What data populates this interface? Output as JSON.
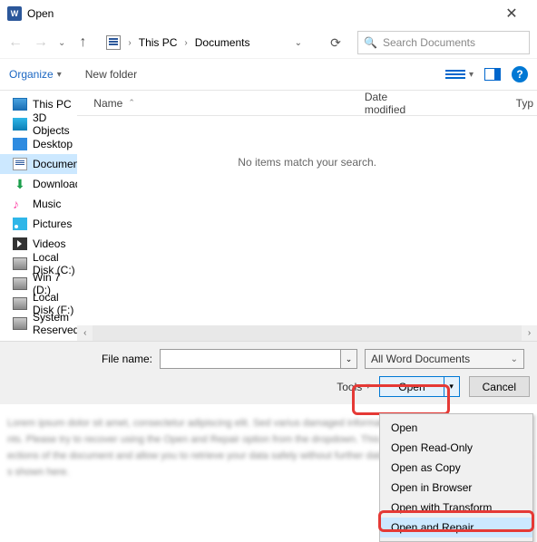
{
  "title": "Open",
  "breadcrumb": {
    "root": "This PC",
    "folder": "Documents"
  },
  "search_placeholder": "Search Documents",
  "toolbar": {
    "organize": "Organize",
    "newfolder": "New folder"
  },
  "tree": [
    {
      "label": "This PC",
      "icon": "i-pc"
    },
    {
      "label": "3D Objects",
      "icon": "i-3d"
    },
    {
      "label": "Desktop",
      "icon": "i-desk"
    },
    {
      "label": "Documents",
      "icon": "i-doc",
      "selected": true
    },
    {
      "label": "Downloads",
      "icon": "i-dl",
      "glyph": "⬇"
    },
    {
      "label": "Music",
      "icon": "i-mus",
      "glyph": "♪"
    },
    {
      "label": "Pictures",
      "icon": "i-pic"
    },
    {
      "label": "Videos",
      "icon": "i-vid"
    },
    {
      "label": "Local Disk (C:)",
      "icon": "i-disk"
    },
    {
      "label": "Win 7 (D:)",
      "icon": "i-disk"
    },
    {
      "label": "Local Disk (F:)",
      "icon": "i-disk"
    },
    {
      "label": "System Reserved",
      "icon": "i-disk",
      "chev": true
    }
  ],
  "columns": {
    "name": "Name",
    "date": "Date modified",
    "type": "Typ"
  },
  "empty_msg": "No items match your search.",
  "footer": {
    "filename_label": "File name:",
    "filter": "All Word Documents",
    "tools": "Tools",
    "open": "Open",
    "cancel": "Cancel"
  },
  "menu": {
    "items": [
      "Open",
      "Open Read-Only",
      "Open as Copy",
      "Open in Browser",
      "Open with Transform",
      "Open and Repair"
    ]
  },
  "blurred_text": "Lorem ipsum dolor sit amet, consectetur adipiscing elit. Sed varius damaged information. Unable to read the file contents. Please try to recover using the Open and Repair option from the dropdown. This may help restore the corrupted sections of the document and allow you to retrieve your data safely without further data loss occurring during the process shown here."
}
